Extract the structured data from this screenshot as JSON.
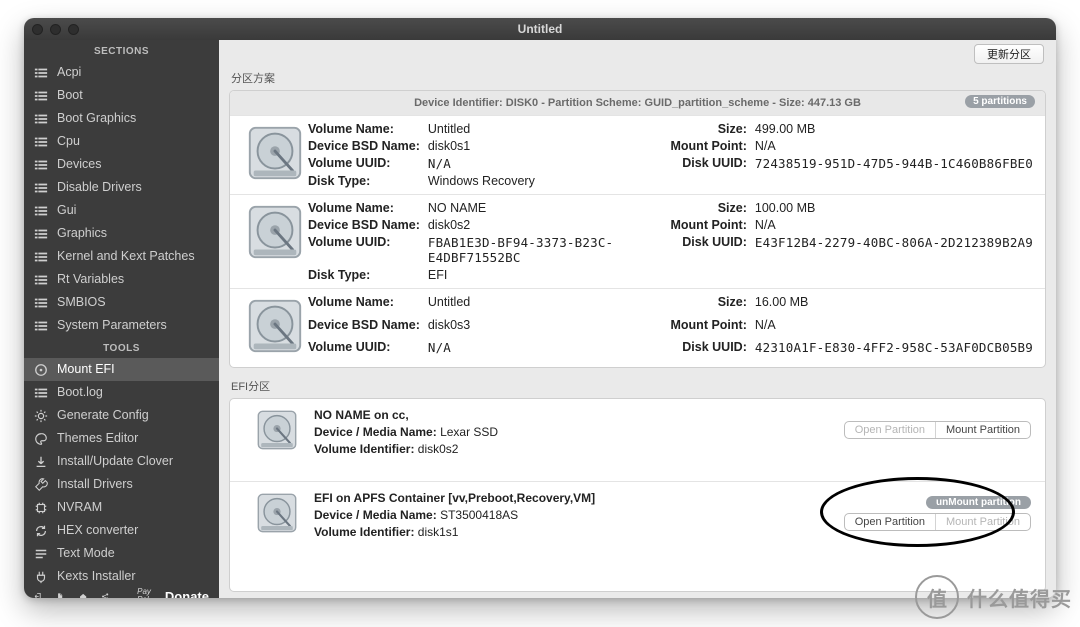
{
  "window": {
    "title": "Untitled"
  },
  "sidebar": {
    "sectionsLabel": "SECTIONS",
    "toolsLabel": "TOOLS",
    "sections": [
      {
        "label": "Acpi"
      },
      {
        "label": "Boot"
      },
      {
        "label": "Boot Graphics"
      },
      {
        "label": "Cpu"
      },
      {
        "label": "Devices"
      },
      {
        "label": "Disable Drivers"
      },
      {
        "label": "Gui"
      },
      {
        "label": "Graphics"
      },
      {
        "label": "Kernel and Kext Patches"
      },
      {
        "label": "Rt Variables"
      },
      {
        "label": "SMBIOS"
      },
      {
        "label": "System Parameters"
      }
    ],
    "tools": [
      {
        "label": "Mount EFI",
        "active": true
      },
      {
        "label": "Boot.log"
      },
      {
        "label": "Generate Config"
      },
      {
        "label": "Themes Editor"
      },
      {
        "label": "Install/Update Clover"
      },
      {
        "label": "Install Drivers"
      },
      {
        "label": "NVRAM"
      },
      {
        "label": "HEX converter"
      },
      {
        "label": "Text Mode"
      },
      {
        "label": "Kexts Installer"
      }
    ],
    "paypal_1": "Pay",
    "paypal_2": "Pal",
    "donate": "Donate"
  },
  "main": {
    "updateBtn": "更新分区",
    "partitionSchemeTitle": "分区方案",
    "partitionsBadge": "5 partitions",
    "diskIdentifier": "Device Identifier: DISK0 - Partition Scheme: GUID_partition_scheme - Size: 447.13 GB",
    "labels": {
      "volumeName": "Volume Name:",
      "deviceBSD": "Device BSD Name:",
      "volumeUUID": "Volume UUID:",
      "diskType": "Disk Type:",
      "size": "Size:",
      "mountPoint": "Mount Point:",
      "diskUUID": "Disk UUID:",
      "deviceMedia": "Device / Media Name:",
      "volumeIdentifier": "Volume Identifier:"
    },
    "partitions": [
      {
        "volumeName": "Untitled",
        "bsd": "disk0s1",
        "volumeUUID": "N/A",
        "diskType": "Windows Recovery",
        "size": "499.00 MB",
        "mountPoint": "N/A",
        "diskUUID": "72438519-951D-47D5-944B-1C460B86FBE0"
      },
      {
        "volumeName": "NO NAME",
        "bsd": "disk0s2",
        "volumeUUID": "FBAB1E3D-BF94-3373-B23C-E4DBF71552BC",
        "diskType": "EFI",
        "size": "100.00 MB",
        "mountPoint": "N/A",
        "diskUUID": "E43F12B4-2279-40BC-806A-2D212389B2A9"
      },
      {
        "volumeName": "Untitled",
        "bsd": "disk0s3",
        "volumeUUID": "N/A",
        "diskType": "",
        "size": "16.00 MB",
        "mountPoint": "N/A",
        "diskUUID": "42310A1F-E830-4FF2-958C-53AF0DCB05B9"
      }
    ],
    "efiTitle": "EFI分区",
    "efi": [
      {
        "title": "NO NAME on cc,",
        "media": "Lexar SSD",
        "vid": "disk0s2",
        "open": "Open Partition",
        "mount": "Mount Partition",
        "openDisabled": true,
        "mountDisabled": false,
        "showUnmount": false
      },
      {
        "title": "EFI on APFS Container [vv,Preboot,Recovery,VM]",
        "media": "ST3500418AS",
        "vid": "disk1s1",
        "open": "Open Partition",
        "mount": "Mount Partition",
        "unmount": "unMount partition",
        "openDisabled": false,
        "mountDisabled": true,
        "showUnmount": true
      }
    ]
  },
  "watermark": {
    "icon": "值",
    "text": "什么值得买"
  }
}
